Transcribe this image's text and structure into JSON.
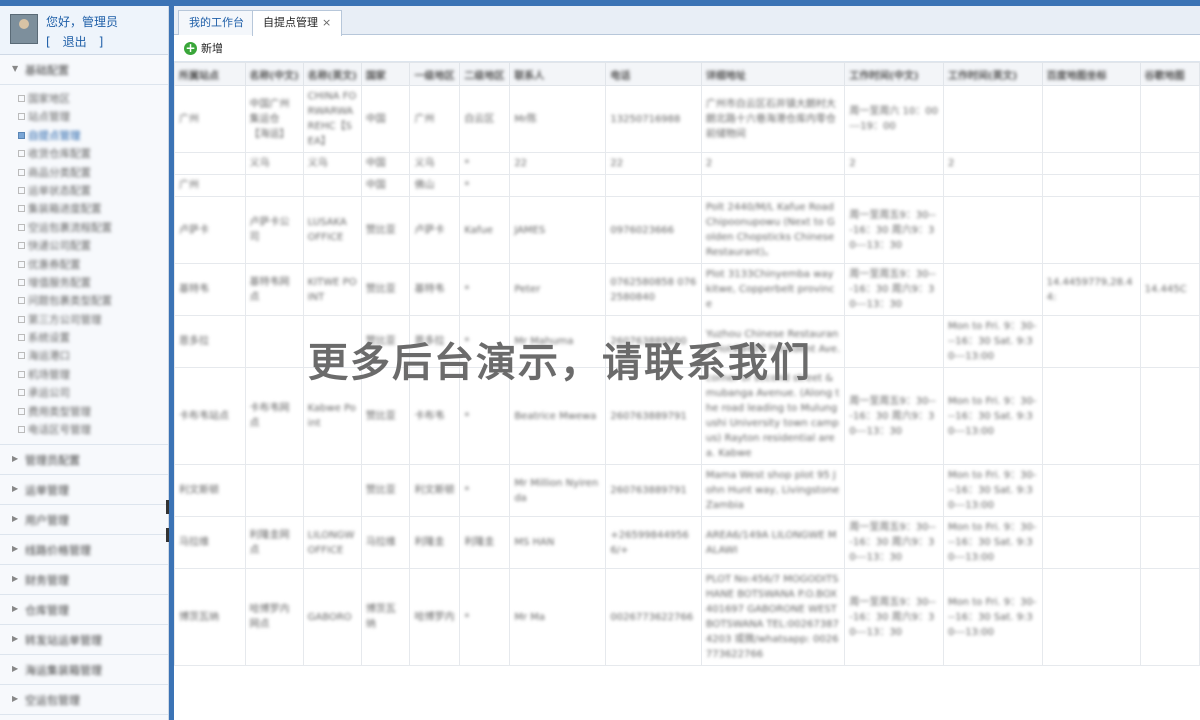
{
  "user": {
    "greeting": "您好，管理员",
    "logout": "[　退出　]"
  },
  "sidebar": {
    "expanded_section": "基础配置",
    "items": [
      "国家地区",
      "站点管理",
      "自提点管理",
      "收货仓库配置",
      "商品分类配置",
      "运单状态配置",
      "集装箱进度配置",
      "空运包裹流程配置",
      "快递公司配置",
      "优惠券配置",
      "增值服务配置",
      "问题包裹类型配置",
      "第三方公司管理",
      "系统设置",
      "海运港口",
      "机场管理",
      "承运公司",
      "费用类型管理",
      "电话区号管理"
    ],
    "active_index": 2,
    "sections": [
      "管理员配置",
      "运单管理",
      "用户管理",
      "线路价格管理",
      "财务管理",
      "仓库管理",
      "转发站运单管理",
      "海运集装箱管理",
      "空运包管理"
    ]
  },
  "tabs": [
    {
      "label": "我的工作台"
    },
    {
      "label": "自提点管理",
      "close": "×"
    }
  ],
  "toolbar": {
    "add_label": "新增"
  },
  "table": {
    "columns": [
      "所属站点",
      "名称(中文)",
      "名称(英文)",
      "国家",
      "一级地区",
      "二级地区",
      "联系人",
      "电话",
      "详细地址",
      "工作时间(中文)",
      "工作时间(英文)",
      "百度地图坐标",
      "谷歌地图"
    ],
    "rows": [
      [
        "广州",
        "中国广州集运仓【海运】",
        "CHINA FORWARWAREHC【SEA】",
        "中国",
        "广州",
        "白云区",
        "Mr陈",
        "13250716988",
        "广州市白云区石井镇大朗村大朗北路十六巷海港仓库内零仓前储物间",
        "周一至周六 10：00---19：00",
        "",
        "",
        ""
      ],
      [
        "",
        "义乌",
        "义乌",
        "中国",
        "义乌",
        "*",
        "22",
        "22",
        "2",
        "2",
        "2",
        "",
        ""
      ],
      [
        "广州",
        "",
        "",
        "中国",
        "佛山",
        "*",
        "",
        "",
        "",
        "",
        "",
        "",
        ""
      ],
      [
        "卢萨卡",
        "卢萨卡公司",
        "LUSAKA OFFICE",
        "赞比亚",
        "卢萨卡",
        "Kafue",
        "JAMES",
        "0976023666",
        "Polt 2440/M/L Kafue Road Chipoonupowu (Next to Golden Chopsticks Chinese Restaurant)。",
        "周一至周五9：30---16：30 周六9：30---13：30",
        "",
        "",
        ""
      ],
      [
        "基特韦",
        "基特韦网点",
        "KITWE POINT",
        "赞比亚",
        "基特韦",
        "*",
        "Peter",
        "0762580858 0762580840",
        "Plot 3133Chinyemba way kitwe, Copperbelt province",
        "周一至周五9：30---16：30 周六9：30---13：30",
        "",
        "14.4459779,28.44:",
        "14.445C"
      ],
      [
        "恩多拉",
        "",
        "",
        "赞比亚",
        "恩多拉",
        "*",
        "Mr Mahuma",
        "260763889800",
        "Yuzhou Chinese Restaurant Plot#9487 President Ave.",
        "",
        "Mon to Fri. 9：30---16：30 Sat. 9:30---13:00",
        "",
        ""
      ],
      [
        "卡布韦站点",
        "卡布韦网点",
        "Kabwe Point",
        "赞比亚",
        "卡布韦",
        "*",
        "Beatrice Mwewa",
        "260763889791",
        "corner of second street & mubanga Avenue. (Along the road leading to Mulungushi University town campus) Rayton residential area. Kabwe",
        "周一至周五9：30---16：30 周六9：30---13：30",
        "Mon to Fri. 9：30---16：30 Sat. 9:30---13:00",
        "",
        ""
      ],
      [
        "利文斯顿",
        "",
        "",
        "赞比亚",
        "利文斯顿",
        "*",
        "Mr Million Nyirenda",
        "260763889791",
        "Mama West shop plot 95 John Hunt way, Livingstone Zambia",
        "",
        "Mon to Fri. 9：30---16：30 Sat. 9:30---13:00",
        "",
        ""
      ],
      [
        "马拉维",
        "利隆圭网点",
        "LILONGW OFFICE",
        "马拉维",
        "利隆圭",
        "利隆圭",
        "MS HAN",
        "+265998449566/+",
        "AREA6/149A LILONGWE MALAWI",
        "周一至周五9：30---16：30 周六9：30---13：30",
        "Mon to Fri. 9：30---16：30 Sat. 9:30---13:00",
        "",
        ""
      ],
      [
        "博茨瓦纳",
        "哈博罗内网点",
        "GABORO",
        "博茨瓦纳",
        "哈博罗内",
        "*",
        "Mr Ma",
        "0026773622766",
        "PLOT No:456/7 MOGODITSHANE BOTSWANA P.O.BOX401697 GABORONE WEST BOTSWANA TEL:002673874203 或微/whatsapp: 0026773622766",
        "周一至周五9：30---16：30 周六9：30---13：30",
        "Mon to Fri. 9：30---16：30 Sat. 9:30---13:00",
        "",
        ""
      ]
    ]
  },
  "overlay": {
    "text": "更多后台演示，请联系我们"
  },
  "colors": {
    "accent": "#3b73b5",
    "link": "#1f5fa8",
    "add_icon": "#3aa63a"
  }
}
